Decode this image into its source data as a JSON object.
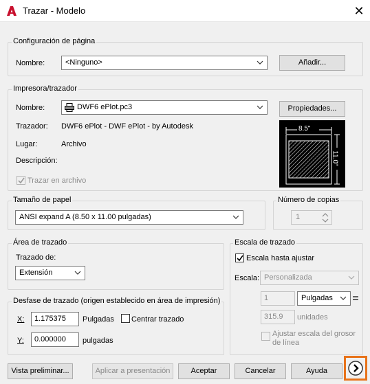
{
  "window": {
    "title": "Trazar - Modelo",
    "close_glyph": "✕"
  },
  "page_setup": {
    "group_label": "Configuración de página",
    "name_label": "Nombre:",
    "name_value": "<Ninguno>",
    "add_button": "Añadir..."
  },
  "printer": {
    "group_label": "Impresora/trazador",
    "name_label": "Nombre:",
    "name_value": "DWF6 ePlot.pc3",
    "properties_button": "Propiedades...",
    "plotter_label": "Trazador:",
    "plotter_value": "DWF6 ePlot - DWF ePlot - by Autodesk",
    "location_label": "Lugar:",
    "location_value": "Archivo",
    "description_label": "Descripción:",
    "plot_to_file_label": "Trazar en archivo",
    "plot_to_file_checked": true,
    "preview_width_label": "8.5\"",
    "preview_height_label": "11.0\""
  },
  "paper_size": {
    "group_label": "Tamaño de papel",
    "value": "ANSI expand A (8.50 x 11.00 pulgadas)"
  },
  "copies": {
    "group_label": "Número de copias",
    "value": "1"
  },
  "plot_area": {
    "group_label": "Área de trazado",
    "what_label": "Trazado de:",
    "what_value": "Extensión"
  },
  "plot_offset": {
    "group_label": "Desfase de trazado (origen establecido en área de impresión)",
    "x_label": "X:",
    "x_value": "1.175375",
    "x_unit": "Pulgadas",
    "center_label": "Centrar trazado",
    "y_label": "Y:",
    "y_value": "0.000000",
    "y_unit": "pulgadas"
  },
  "plot_scale": {
    "group_label": "Escala de trazado",
    "fit_label": "Escala hasta ajustar",
    "fit_checked": true,
    "scale_label": "Escala:",
    "scale_value": "Personalizada",
    "ratio_left": "1",
    "unit_value": "Pulgadas",
    "ratio_right": "315.9",
    "units_label": "unidades",
    "lineweights_label_1": "Ajustar escala del grosor",
    "lineweights_label_2": "de línea"
  },
  "footer": {
    "preview_button": "Vista preliminar...",
    "apply_button": "Aplicar a presentación",
    "ok_button": "Aceptar",
    "cancel_button": "Cancelar",
    "help_button": "Ayuda"
  },
  "colors": {
    "accent_orange": "#e8731a",
    "autocad_red": "#c8102e"
  }
}
